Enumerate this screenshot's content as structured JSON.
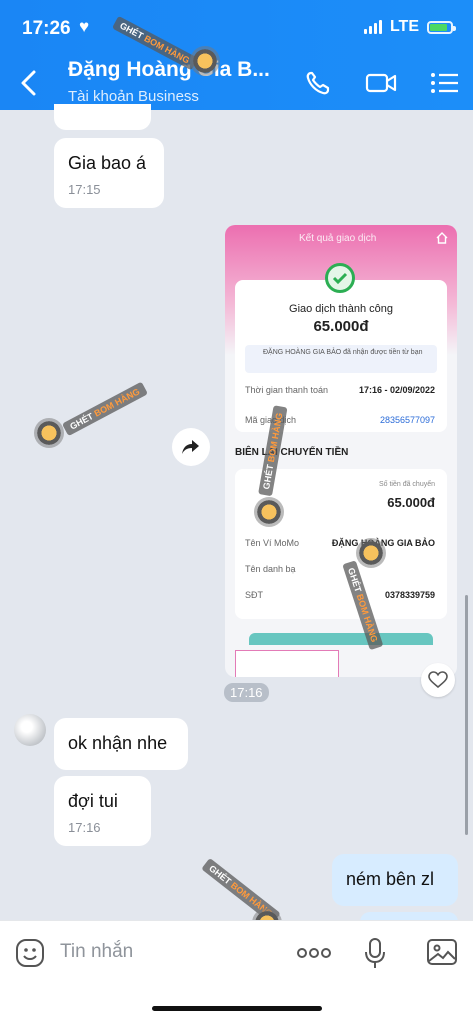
{
  "status": {
    "time": "17:26",
    "network": "LTE"
  },
  "header": {
    "name": "Đặng Hoàng Gia B...",
    "subtitle": "Tài khoản Business"
  },
  "messages": [
    {
      "from": "them",
      "text": "Gia bao á",
      "time": "17:15"
    },
    {
      "from": "them",
      "text": "ok nhận nhe"
    },
    {
      "from": "them",
      "text": "đợi tui",
      "time": "17:16"
    },
    {
      "from": "me",
      "text": "ném bên zl"
    }
  ],
  "image_time": "17:16",
  "receipt": {
    "header": "Kết quả giao dịch",
    "status": "Giao dịch thành công",
    "amount": "65.000đ",
    "note": "ĐẶNG HOÀNG GIA BẢO đã nhận được tiền từ bạn",
    "time_label": "Thời gian thanh toán",
    "time_value": "17:16 - 02/09/2022",
    "txn_label": "Mã giao dịch",
    "txn_value": "28356577097",
    "section": "BIÊN LAI CHUYỂN TIỀN",
    "transfer_label": "Số tiền đã chuyển",
    "transfer_amount": "65.000đ",
    "wallet_label": "Tên Ví MoMo",
    "wallet_value": "ĐẶNG HOÀNG GIA BẢO",
    "contact_label": "Tên danh bạ",
    "phone_label": "SĐT",
    "phone_value": "0378339759"
  },
  "watermark": {
    "part1": "GHÉT",
    "part2": "BOM HÀNG"
  },
  "input": {
    "placeholder": "Tin nhắn"
  },
  "colors": {
    "header": "#1a86f5",
    "my_bubble": "#d7ecff",
    "momo_pink": "#ec6fb0",
    "success": "#2cae53"
  }
}
